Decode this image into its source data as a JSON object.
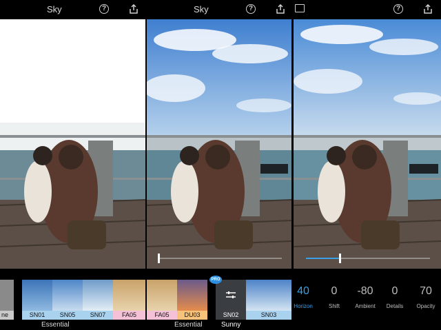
{
  "header": {
    "title_left": "Sky",
    "title_middle": "Sky"
  },
  "icons": {
    "photo": "photo-icon",
    "help": "help-icon",
    "share": "share-icon"
  },
  "help_glyph": "?",
  "presets": {
    "panel1": {
      "partial_label": "ne",
      "items": [
        "SN01",
        "SN05",
        "SN07",
        "FA05"
      ],
      "category": "Essential"
    },
    "panel2": {
      "items": [
        "FA05",
        "DU03",
        "SN02"
      ],
      "category": "Essential",
      "selected_category": "Sunny",
      "pro_badge": "PRO"
    },
    "panel3": {
      "items": [
        "SN03"
      ]
    }
  },
  "adjustments": [
    {
      "label": "Horizon",
      "value": "40",
      "active": true
    },
    {
      "label": "Shift",
      "value": "0",
      "active": false
    },
    {
      "label": "Ambient",
      "value": "-80",
      "active": false
    },
    {
      "label": "Details",
      "value": "0",
      "active": false
    },
    {
      "label": "Opacity",
      "value": "70",
      "active": false
    }
  ],
  "sliders": {
    "panel2_position": 0.0,
    "panel3_position": 0.4
  },
  "colors": {
    "accent": "#3aa0e8",
    "label_blue": "#a9d2ef",
    "label_pink": "#f4c1d7",
    "label_orange": "#f7c27a",
    "label_gray": "#c9c9c9"
  }
}
